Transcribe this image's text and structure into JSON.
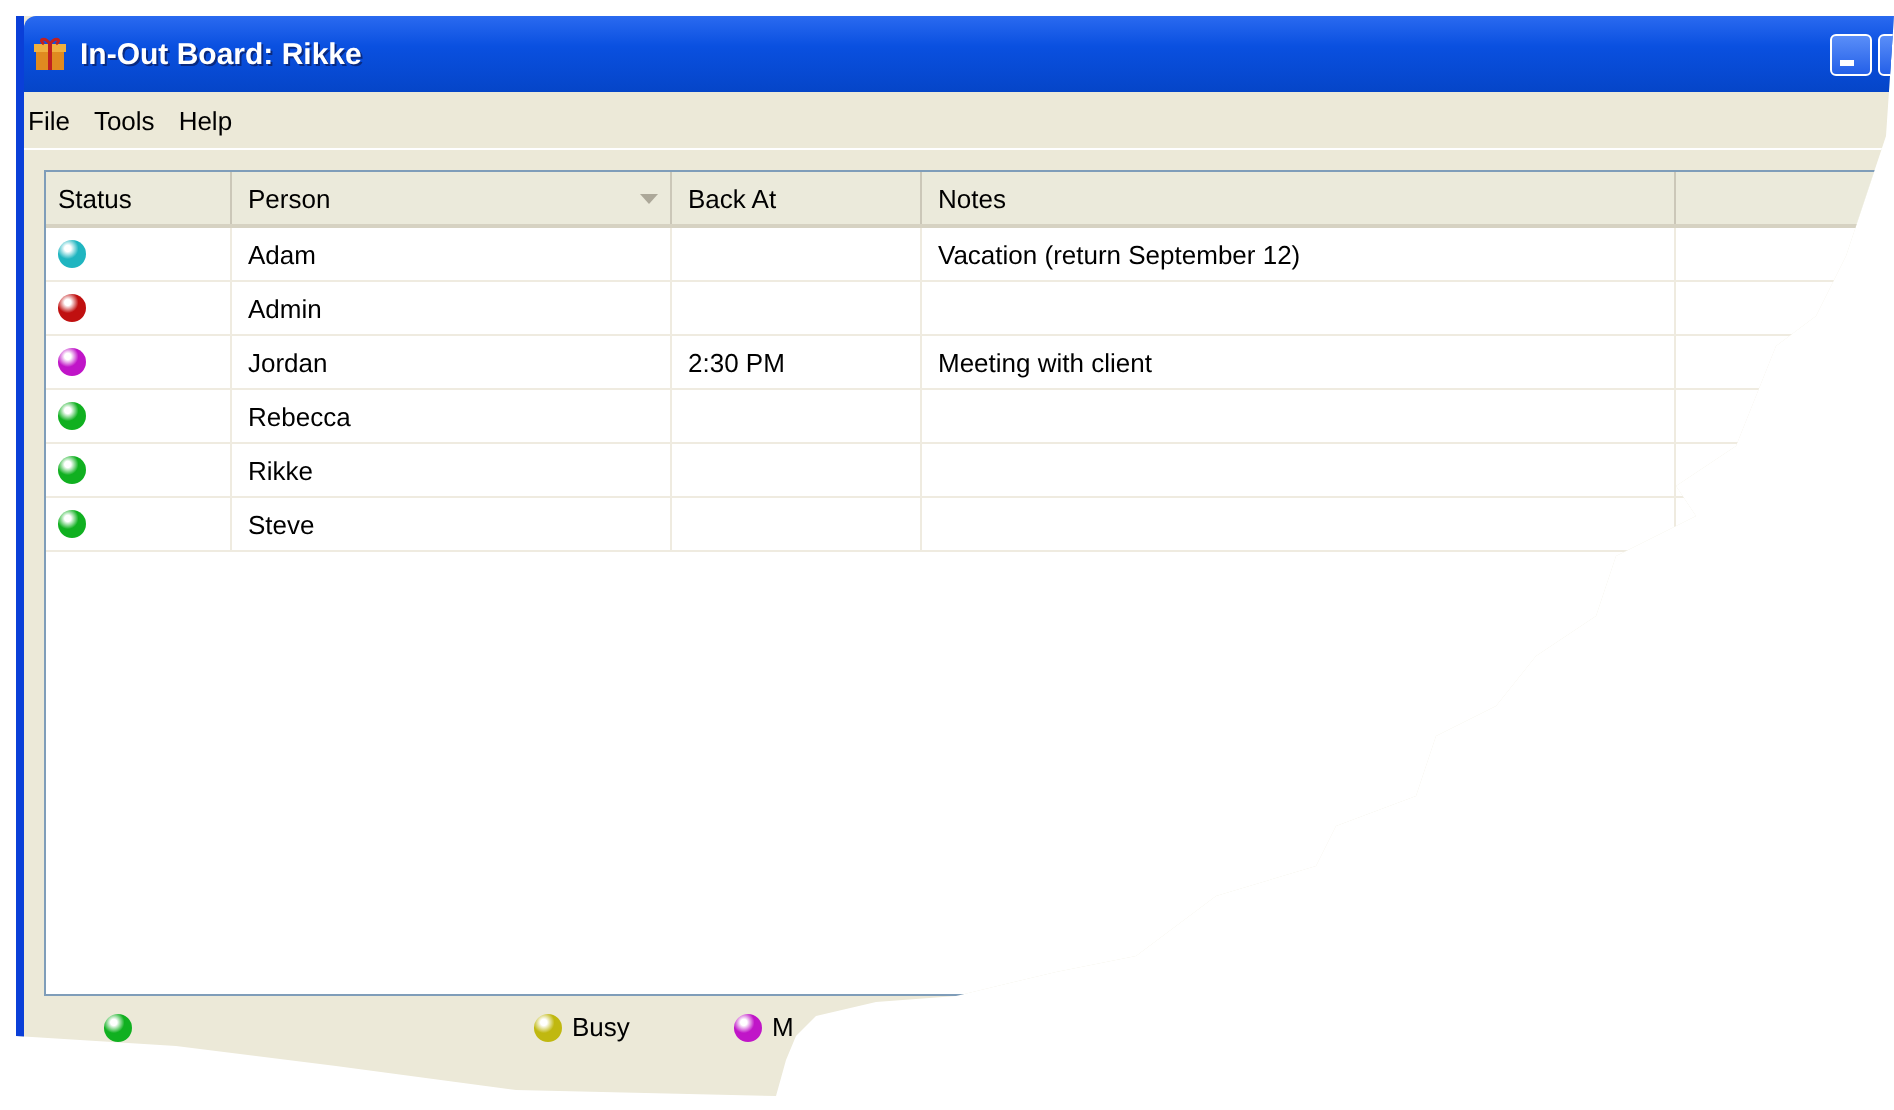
{
  "window": {
    "title": "In-Out Board: Rikke"
  },
  "menu": [
    "File",
    "Tools",
    "Help"
  ],
  "table": {
    "columns": [
      "Status",
      "Person",
      "Back At",
      "Notes"
    ],
    "rows": [
      {
        "color": "#1fb5c0",
        "person": "Adam",
        "notes": "Vacation (return September 12)"
      },
      {
        "color": "#c01010",
        "person": "Admin"
      },
      {
        "color": "#c015c8",
        "person": "Jordan",
        "back_at": "2:30 PM",
        "notes": "Meeting with client"
      },
      {
        "color": "#10b020",
        "person": "Rebecca"
      },
      {
        "color": "#10b020",
        "person": "Rikke"
      },
      {
        "color": "#10b020",
        "person": "Steve"
      }
    ]
  },
  "legend": [
    {
      "color": "#10b020"
    },
    {
      "color": "#c0b810",
      "label": "Busy"
    },
    {
      "color": "#c015c8",
      "label": "M"
    }
  ]
}
